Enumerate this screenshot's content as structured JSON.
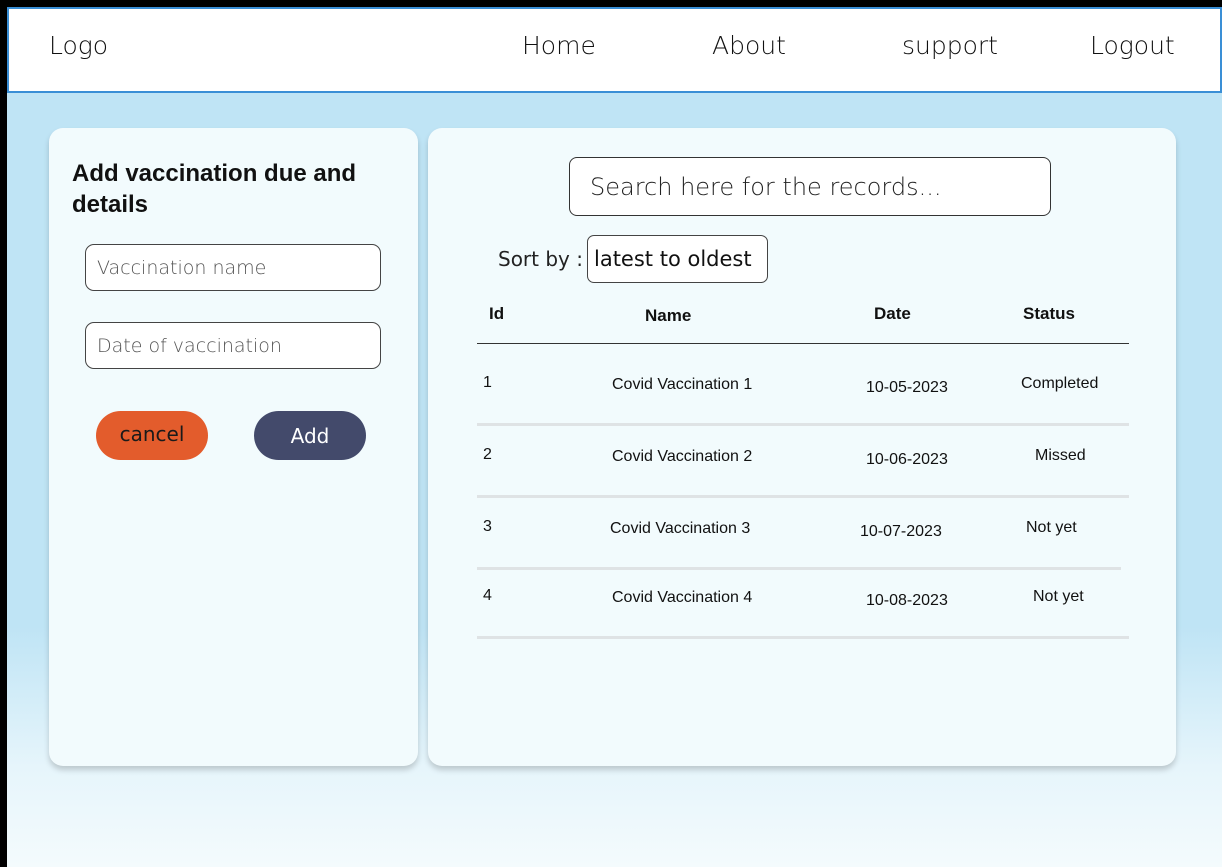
{
  "nav": {
    "logo": "Logo",
    "home": "Home",
    "about": "About",
    "support": "support",
    "logout": "Logout"
  },
  "form": {
    "title": "Add vaccination due and details",
    "name_placeholder": "Vaccination name",
    "date_placeholder": "Date of vaccination",
    "cancel_label": "cancel",
    "add_label": "Add"
  },
  "records": {
    "search_placeholder": "Search here for the records...",
    "sort_label": "Sort by :",
    "sort_value": "latest to oldest",
    "columns": [
      "Id",
      "Name",
      "Date",
      "Status"
    ],
    "rows": [
      {
        "id": "1",
        "name": "Covid Vaccination 1",
        "date": "10-05-2023",
        "status": "Completed"
      },
      {
        "id": "2",
        "name": "Covid Vaccination 2",
        "date": "10-06-2023",
        "status": "Missed"
      },
      {
        "id": "3",
        "name": "Covid Vaccination 3",
        "date": "10-07-2023",
        "status": "Not yet"
      },
      {
        "id": "4",
        "name": "Covid Vaccination 4",
        "date": "10-08-2023",
        "status": "Not yet"
      }
    ]
  },
  "colors": {
    "background": "#bfe4f5",
    "nav_border": "#3a8fd6",
    "cancel": "#e35c2c",
    "add": "#434a6b"
  }
}
